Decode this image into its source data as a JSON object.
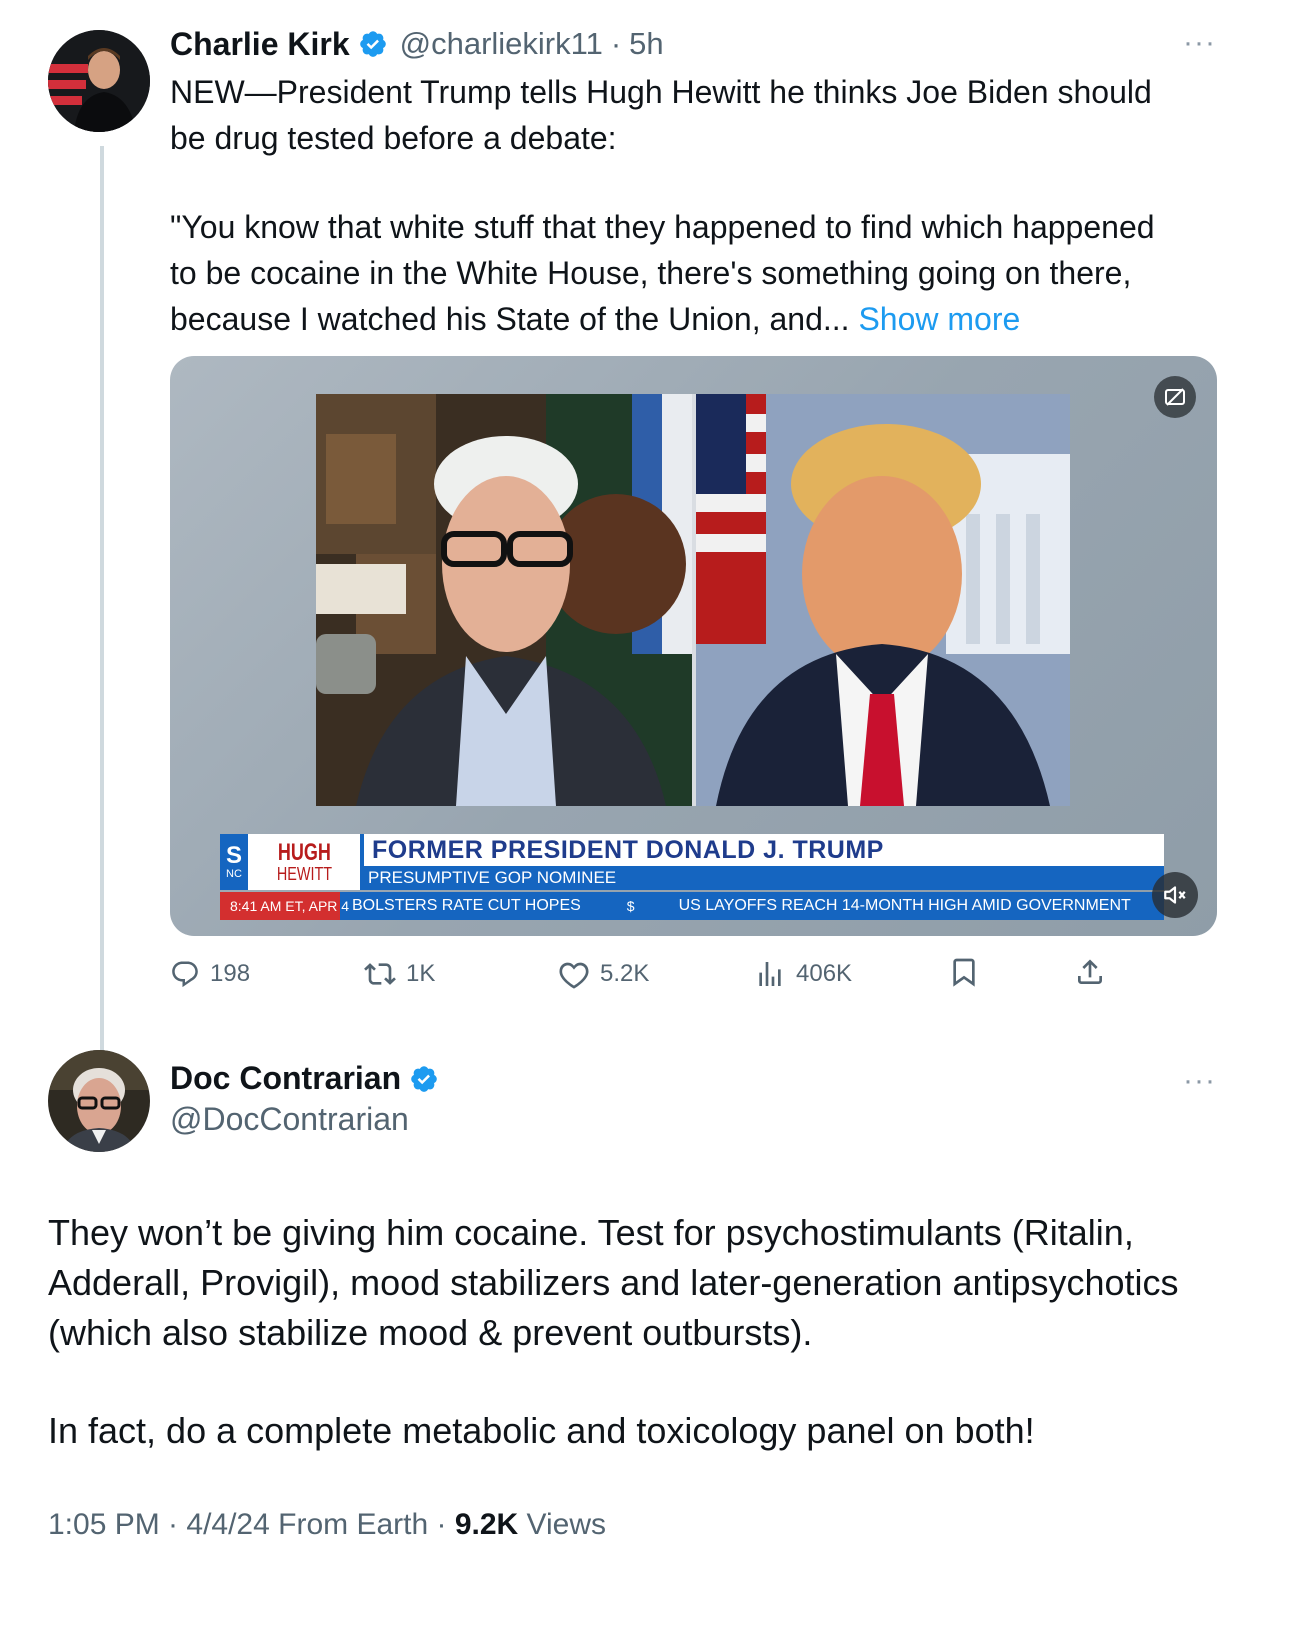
{
  "tweet1": {
    "author_name": "Charlie Kirk",
    "handle": "@charliekirk11",
    "separator": "·",
    "time": "5h",
    "more": "···",
    "text_para1_line1": "NEW—President Trump tells Hugh Hewitt he thinks Joe Biden should",
    "text_para1_line2": "be drug tested before a debate:",
    "text_para2_line1": "\"You know that white stuff that they happened to find which happened",
    "text_para2_line2": "to be cocaine in the White House, there's something going on there,",
    "text_para2_line3": "because I watched his State of the Union, and...",
    "show_more": "Show more",
    "video": {
      "logo_s": "S",
      "logo_nc": "NC",
      "logo_hugh": "HUGH",
      "logo_hewitt": "HEWITT",
      "lower_third_title": "FORMER PRESIDENT DONALD J. TRUMP",
      "lower_third_subtitle": "PRESUMPTIVE GOP NOMINEE",
      "timestamp": "8:41 AM ET, APR 4",
      "ticker_item1": "BOLSTERS RATE CUT HOPES",
      "ticker_dollar": "$",
      "ticker_item2": "US LAYOFFS REACH 14-MONTH HIGH AMID GOVERNMENT"
    },
    "actions": {
      "replies": "198",
      "reposts": "1K",
      "likes": "5.2K",
      "views": "406K"
    }
  },
  "tweet2": {
    "author_name": "Doc Contrarian",
    "handle": "@DocContrarian",
    "more": "···",
    "text_para1_line1": "They won’t be giving him cocaine. Test for psychostimulants (Ritalin,",
    "text_para1_line2": "Adderall, Provigil), mood stabilizers and later-generation antipsychotics",
    "text_para1_line3": "(which also stabilize mood & prevent outbursts).",
    "text_para2": "In fact, do a complete metabolic and toxicology panel on both!",
    "meta_time": "1:05 PM · 4/4/24 From Earth ·",
    "meta_views_count": "9.2K",
    "meta_views_label": "Views"
  },
  "colors": {
    "accent": "#1d9bf0",
    "text": "#0f1419",
    "muted": "#536471",
    "thread_line": "#cfd9de",
    "ticker_blue": "#1565c0",
    "ticker_red": "#d32f2f"
  },
  "icons": [
    "verified-badge-icon",
    "more-icon",
    "reply-icon",
    "repost-icon",
    "like-icon",
    "views-icon",
    "bookmark-icon",
    "share-icon",
    "captions-off-icon",
    "mute-icon"
  ]
}
